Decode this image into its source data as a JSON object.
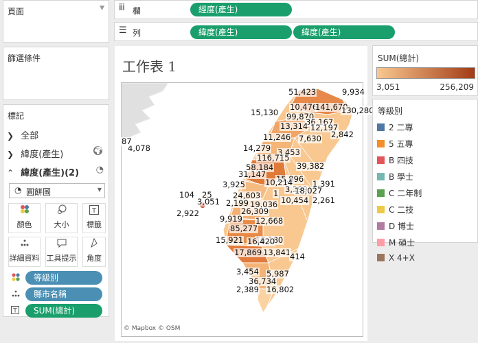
{
  "pages": {
    "title": "頁面"
  },
  "filters": {
    "title": "篩選條件"
  },
  "columns_shelf": {
    "icon": "columns-icon",
    "label": "欄",
    "pill": "經度(產生)"
  },
  "rows_shelf": {
    "icon": "rows-icon",
    "label": "列",
    "pills": [
      "緯度(產生)",
      "緯度(產生)"
    ]
  },
  "marks": {
    "title": "標記",
    "layers": [
      {
        "label": "全部",
        "expanded": false
      },
      {
        "label": "緯度(產生)",
        "expanded": false
      },
      {
        "label": "緯度(產生)(2)",
        "expanded": true
      }
    ],
    "mark_type": "圓餅圖",
    "buttons": [
      "顏色",
      "大小",
      "標籤",
      "詳細資料",
      "工具提示",
      "角度"
    ],
    "fields": [
      {
        "icon": "color-icon",
        "label": "等級別",
        "color": "#4b90b4"
      },
      {
        "icon": "detail-icon",
        "label": "縣市名稱",
        "color": "#4b90b4"
      },
      {
        "icon": "label-icon",
        "label": "SUM(總計)",
        "color": "#1a9f6c"
      }
    ]
  },
  "worksheet": {
    "title": "工作表 1",
    "attribution": "© Mapbox © OSM"
  },
  "sum_legend": {
    "title": "SUM(總計)",
    "min": "3,051",
    "max": "256,209",
    "color_low": "#f9c891",
    "color_high": "#a23c16"
  },
  "category_legend": {
    "title": "等級別",
    "items": [
      {
        "label": "2 二專",
        "color": "#4e79a7"
      },
      {
        "label": "5 五專",
        "color": "#f28e2b"
      },
      {
        "label": "B 四技",
        "color": "#e15759"
      },
      {
        "label": "B 學士",
        "color": "#76b7b2"
      },
      {
        "label": "C 二年制",
        "color": "#59a14f"
      },
      {
        "label": "C 二技",
        "color": "#edc948"
      },
      {
        "label": "D 博士",
        "color": "#b07aa1"
      },
      {
        "label": "M 碩士",
        "color": "#ff9da7"
      },
      {
        "label": "X 4+X",
        "color": "#9c755f"
      }
    ]
  },
  "map_labels": [
    "51,423",
    "9,934",
    "10,476",
    "141,670",
    "130,280",
    "15,130",
    "99,870",
    "36,167",
    "13,314",
    "12,197",
    "2,842",
    "11,246",
    "7,630",
    "14,279",
    "3,453",
    "116,715",
    "58,184",
    "39,382",
    "31,147",
    "15,896",
    "3,925",
    "10,214",
    "1,391",
    "3,199",
    "18,027",
    "104",
    "25",
    "24,603",
    "1",
    "10,454",
    "2,261",
    "3,051",
    "2,199",
    "19,036",
    "2,922",
    "26,309",
    "9,919",
    "12,668",
    "85,277",
    "15,921",
    "16,180",
    "16,420",
    "17,869",
    "13,841",
    "414",
    "3,454",
    "5,987",
    "36,734",
    "2,389",
    "16,802",
    "4,078",
    "87"
  ]
}
